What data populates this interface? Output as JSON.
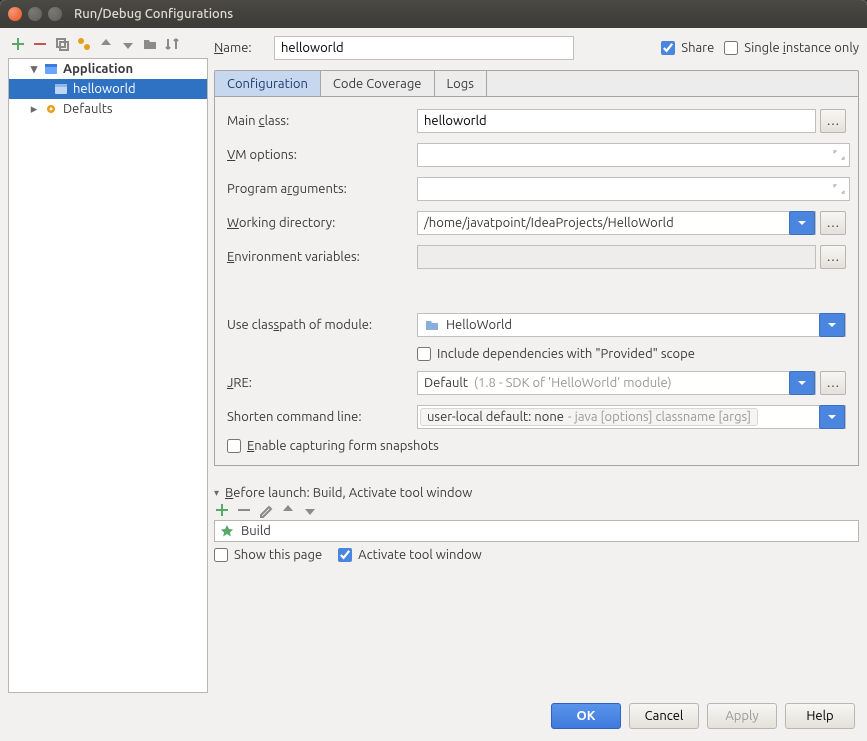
{
  "window": {
    "title": "Run/Debug Configurations"
  },
  "tree": {
    "application_label": "Application",
    "helloworld_label": "helloworld",
    "defaults_label": "Defaults"
  },
  "name_row": {
    "label": "Name:",
    "value": "helloworld",
    "share_label": "Share",
    "single_instance_label": "Single instance only"
  },
  "tabs": {
    "configuration": "Configuration",
    "code_coverage": "Code Coverage",
    "logs": "Logs"
  },
  "form": {
    "main_class_label": "Main class:",
    "main_class_value": "helloworld",
    "vm_options_label": "VM options:",
    "vm_options_value": "",
    "program_args_label": "Program arguments:",
    "program_args_value": "",
    "working_dir_label": "Working directory:",
    "working_dir_value": "/home/javatpoint/IdeaProjects/HelloWorld",
    "env_vars_label": "Environment variables:",
    "env_vars_value": "",
    "classpath_label": "Use classpath of module:",
    "classpath_value": "HelloWorld",
    "include_provided_label": "Include dependencies with \"Provided\" scope",
    "jre_label": "JRE:",
    "jre_value": "Default",
    "jre_hint": "(1.8 - SDK of 'HelloWorld' module)",
    "shorten_label": "Shorten command line:",
    "shorten_value": "user-local default: none",
    "shorten_hint": "- java [options] classname [args]",
    "snapshots_label": "Enable capturing form snapshots"
  },
  "before_launch": {
    "header": "Before launch: Build, Activate tool window",
    "build_item": "Build",
    "show_page_label": "Show this page",
    "activate_tool_label": "Activate tool window"
  },
  "buttons": {
    "ok": "OK",
    "cancel": "Cancel",
    "apply": "Apply",
    "help": "Help"
  }
}
